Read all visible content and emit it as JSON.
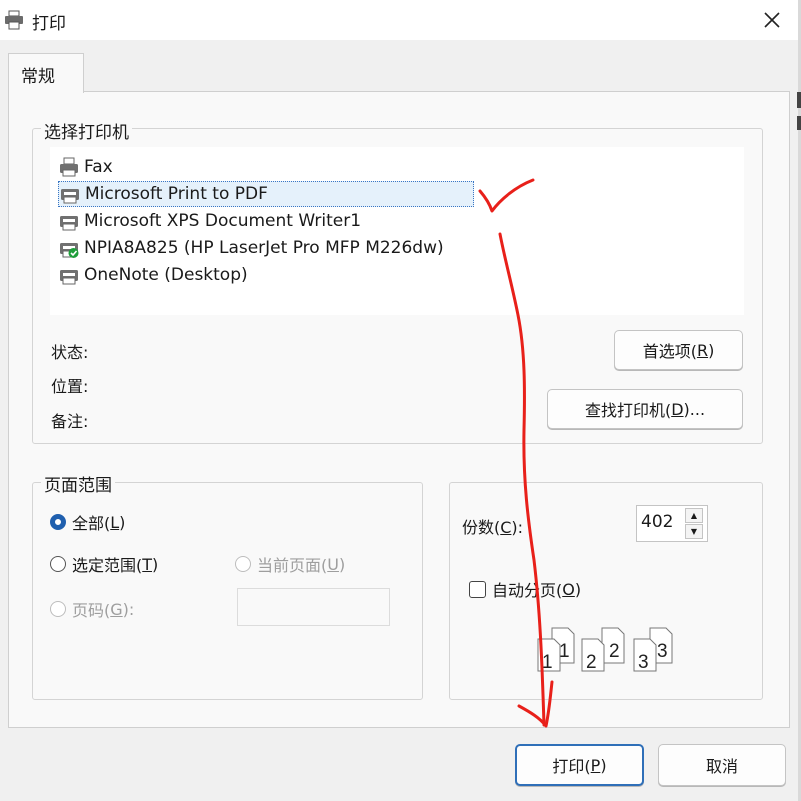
{
  "window": {
    "title": "打印",
    "close_glyph": "✕"
  },
  "tabs": [
    {
      "label": "常规",
      "active": true
    }
  ],
  "printer_section": {
    "legend": "选择打印机",
    "printers": [
      {
        "name": "Fax",
        "selected": false,
        "status_icon": "printer-icon"
      },
      {
        "name": "Microsoft Print to PDF",
        "selected": true,
        "status_icon": "printer-icon"
      },
      {
        "name": "Microsoft XPS Document Writer1",
        "selected": false,
        "status_icon": "printer-icon"
      },
      {
        "name": "NPIA8A825 (HP LaserJet Pro MFP M226dw)",
        "selected": false,
        "status_icon": "default-printer-check-icon"
      },
      {
        "name": "OneNote (Desktop)",
        "selected": false,
        "status_icon": "printer-icon"
      }
    ],
    "status_label": "状态:",
    "location_label": "位置:",
    "comment_label": "备注:",
    "preferences_button": {
      "text": "首选项(",
      "key": "R",
      "tail": ")"
    },
    "find_printer_button": {
      "text": "查找打印机(",
      "key": "D",
      "tail": ")..."
    }
  },
  "page_range": {
    "legend": "页面范围",
    "all": {
      "text": "全部(",
      "key": "L",
      "tail": ")",
      "checked": true
    },
    "selection": {
      "text": "选定范围(",
      "key": "T",
      "tail": ")"
    },
    "current_page": {
      "text": "当前页面(",
      "key": "U",
      "tail": ")",
      "disabled": true
    },
    "pages": {
      "text": "页码(",
      "key": "G",
      "tail": "):",
      "disabled": true
    },
    "pages_value": ""
  },
  "copies": {
    "label_text": "份数(",
    "label_key": "C",
    "label_tail": "):",
    "value": "402",
    "collate": {
      "text": "自动分页(",
      "key": "O",
      "tail": ")",
      "checked": false
    },
    "collate_numbers": [
      "1",
      "1",
      "2",
      "2",
      "3",
      "3"
    ]
  },
  "footer": {
    "print_button": {
      "text": "打印(",
      "key": "P",
      "tail": ")"
    },
    "cancel_button": {
      "text": "取消"
    }
  },
  "colors": {
    "accent": "#1f5fae",
    "annotation": "#e8201a",
    "selection": "#e5f1fb"
  }
}
